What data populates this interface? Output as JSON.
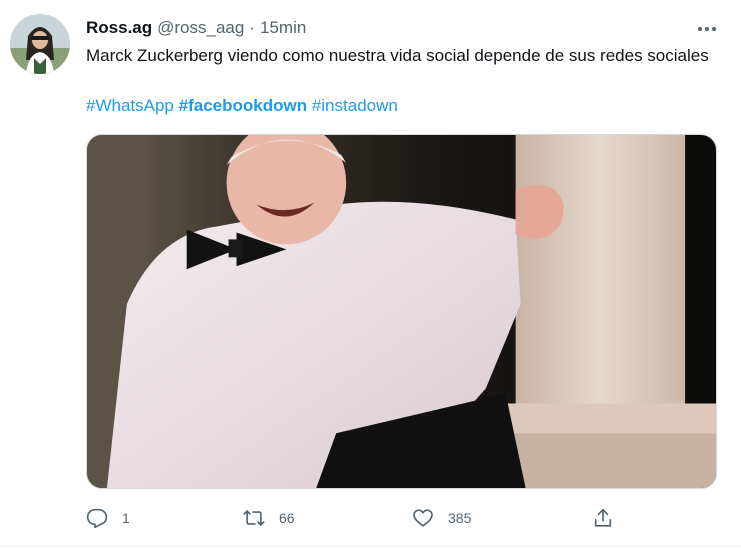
{
  "tweet": {
    "display_name": "Ross.ag",
    "handle": "@ross_aag",
    "separator": "·",
    "time": "15min",
    "text": "Marck Zuckerberg viendo como nuestra vida social depende de sus redes sociales",
    "hashtags": [
      {
        "text": "#WhatsApp",
        "bold": false
      },
      {
        "text": "#facebookdown",
        "bold": true
      },
      {
        "text": "#instadown",
        "bold": false
      }
    ]
  },
  "actions": {
    "reply": {
      "icon": "reply-icon",
      "count": "1"
    },
    "retweet": {
      "icon": "retweet-icon",
      "count": "66"
    },
    "like": {
      "icon": "heart-icon",
      "count": "385"
    },
    "share": {
      "icon": "share-icon",
      "count": ""
    }
  },
  "colors": {
    "link": "#1d9bf0",
    "text": "#0f1419",
    "secondary": "#536471",
    "border": "#cfd9de"
  }
}
